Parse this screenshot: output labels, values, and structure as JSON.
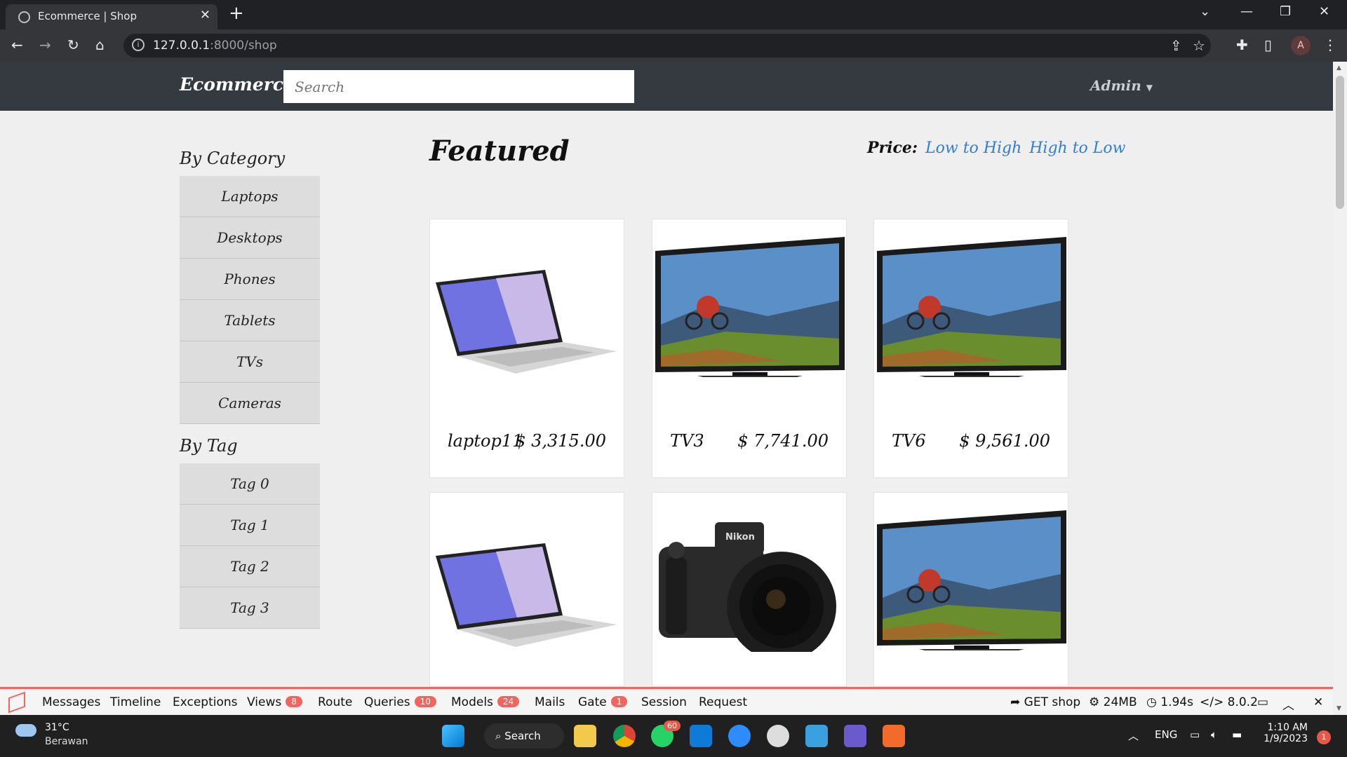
{
  "browser": {
    "tab_title": "Ecommerce | Shop",
    "url_host": "127.0.0.1",
    "url_path": ":8000/shop",
    "profile_initial": "A"
  },
  "site": {
    "brand": "Ecommerce",
    "search_placeholder": "Search",
    "user_menu": "Admin"
  },
  "sidebar": {
    "category_heading": "By Category",
    "categories": [
      "Laptops",
      "Desktops",
      "Phones",
      "Tablets",
      "TVs",
      "Cameras"
    ],
    "tag_heading": "By Tag",
    "tags": [
      "Tag 0",
      "Tag 1",
      "Tag 2",
      "Tag 3"
    ]
  },
  "main": {
    "heading": "Featured",
    "sort_label": "Price:",
    "sort_low_high": "Low to High",
    "sort_high_low": "High to Low"
  },
  "products": [
    {
      "name": "laptop11",
      "price": "$ 3,315.00",
      "image": "laptop"
    },
    {
      "name": "TV3",
      "price": "$ 7,741.00",
      "image": "tv"
    },
    {
      "name": "TV6",
      "price": "$ 9,561.00",
      "image": "tv"
    },
    {
      "name": "",
      "price": "",
      "image": "laptop"
    },
    {
      "name": "",
      "price": "",
      "image": "camera"
    },
    {
      "name": "",
      "price": "",
      "image": "tv"
    }
  ],
  "debugbar": {
    "messages": "Messages",
    "timeline": "Timeline",
    "exceptions": "Exceptions",
    "views": "Views",
    "views_count": "8",
    "route": "Route",
    "queries": "Queries",
    "queries_count": "10",
    "models": "Models",
    "models_count": "24",
    "mails": "Mails",
    "gate": "Gate",
    "gate_count": "1",
    "session": "Session",
    "request": "Request",
    "route_info": "GET shop",
    "memory": "24MB",
    "time": "1.94s",
    "php": "8.0.2"
  },
  "taskbar": {
    "temperature": "31°C",
    "weather": "Berawan",
    "search": "Search",
    "whatsapp_badge": "60",
    "language": "ENG",
    "time": "1:10 AM",
    "date": "1/9/2023",
    "notifications": "1"
  },
  "colors": {
    "navbar": "#343a40",
    "link": "#2f7ed8",
    "debug_accent": "#f4645f"
  }
}
